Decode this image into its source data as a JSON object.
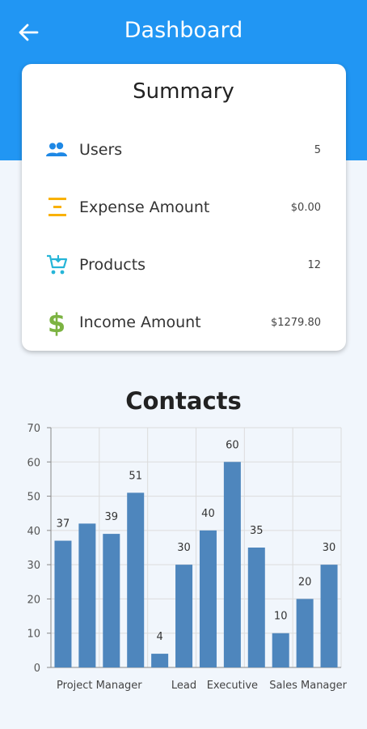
{
  "header": {
    "title": "Dashboard",
    "back_icon": "arrow-back-icon",
    "color": "#2196f3"
  },
  "summary": {
    "title": "Summary",
    "items": [
      {
        "label": "Users",
        "value": "5",
        "icon": "people-icon",
        "icon_color": "#1e88e5"
      },
      {
        "label": "Expense Amount",
        "value": "$0.00",
        "icon": "expense-icon",
        "icon_color": "#f9b100"
      },
      {
        "label": "Products",
        "value": "12",
        "icon": "cart-icon",
        "icon_color": "#26b5d8"
      },
      {
        "label": "Income Amount",
        "value": "$1279.80",
        "icon": "dollar-icon",
        "icon_color": "#7cb342"
      }
    ]
  },
  "chart_data": {
    "type": "bar",
    "title": "Contacts",
    "bar_color": "#4e86bd",
    "values": [
      37,
      42,
      39,
      51,
      4,
      30,
      40,
      60,
      35,
      10,
      20,
      30
    ],
    "value_labels": [
      "37",
      "",
      "39",
      "51",
      "4",
      "30",
      "40",
      "60",
      "35",
      "10",
      "20",
      "30"
    ],
    "x_labels": [
      "Project Manager",
      "Lead",
      "Executive",
      "Sales Manager"
    ],
    "ylim": [
      0,
      70
    ],
    "y_ticks": [
      0,
      10,
      20,
      30,
      40,
      50,
      60,
      70
    ],
    "grid": true
  }
}
